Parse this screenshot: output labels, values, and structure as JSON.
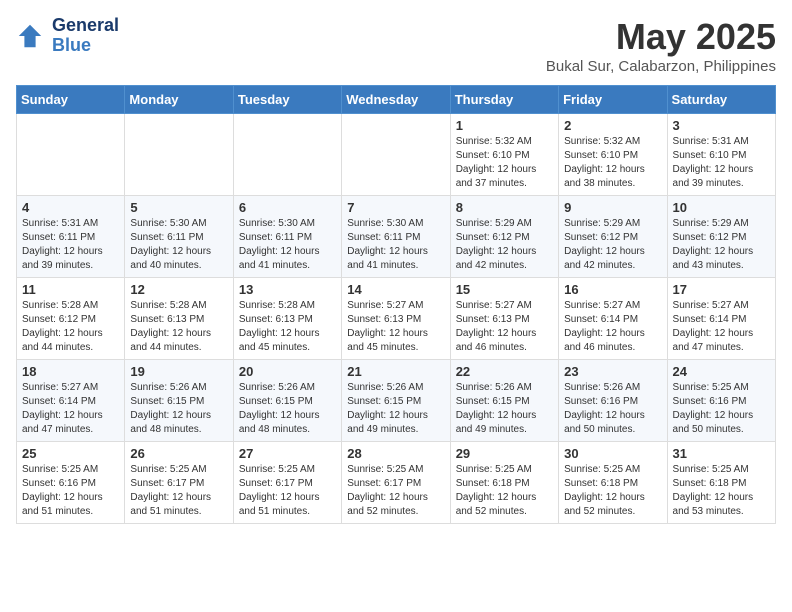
{
  "header": {
    "logo_line1": "General",
    "logo_line2": "Blue",
    "title": "May 2025",
    "subtitle": "Bukal Sur, Calabarzon, Philippines"
  },
  "weekdays": [
    "Sunday",
    "Monday",
    "Tuesday",
    "Wednesday",
    "Thursday",
    "Friday",
    "Saturday"
  ],
  "weeks": [
    [
      {
        "day": "",
        "info": ""
      },
      {
        "day": "",
        "info": ""
      },
      {
        "day": "",
        "info": ""
      },
      {
        "day": "",
        "info": ""
      },
      {
        "day": "1",
        "info": "Sunrise: 5:32 AM\nSunset: 6:10 PM\nDaylight: 12 hours\nand 37 minutes."
      },
      {
        "day": "2",
        "info": "Sunrise: 5:32 AM\nSunset: 6:10 PM\nDaylight: 12 hours\nand 38 minutes."
      },
      {
        "day": "3",
        "info": "Sunrise: 5:31 AM\nSunset: 6:10 PM\nDaylight: 12 hours\nand 39 minutes."
      }
    ],
    [
      {
        "day": "4",
        "info": "Sunrise: 5:31 AM\nSunset: 6:11 PM\nDaylight: 12 hours\nand 39 minutes."
      },
      {
        "day": "5",
        "info": "Sunrise: 5:30 AM\nSunset: 6:11 PM\nDaylight: 12 hours\nand 40 minutes."
      },
      {
        "day": "6",
        "info": "Sunrise: 5:30 AM\nSunset: 6:11 PM\nDaylight: 12 hours\nand 41 minutes."
      },
      {
        "day": "7",
        "info": "Sunrise: 5:30 AM\nSunset: 6:11 PM\nDaylight: 12 hours\nand 41 minutes."
      },
      {
        "day": "8",
        "info": "Sunrise: 5:29 AM\nSunset: 6:12 PM\nDaylight: 12 hours\nand 42 minutes."
      },
      {
        "day": "9",
        "info": "Sunrise: 5:29 AM\nSunset: 6:12 PM\nDaylight: 12 hours\nand 42 minutes."
      },
      {
        "day": "10",
        "info": "Sunrise: 5:29 AM\nSunset: 6:12 PM\nDaylight: 12 hours\nand 43 minutes."
      }
    ],
    [
      {
        "day": "11",
        "info": "Sunrise: 5:28 AM\nSunset: 6:12 PM\nDaylight: 12 hours\nand 44 minutes."
      },
      {
        "day": "12",
        "info": "Sunrise: 5:28 AM\nSunset: 6:13 PM\nDaylight: 12 hours\nand 44 minutes."
      },
      {
        "day": "13",
        "info": "Sunrise: 5:28 AM\nSunset: 6:13 PM\nDaylight: 12 hours\nand 45 minutes."
      },
      {
        "day": "14",
        "info": "Sunrise: 5:27 AM\nSunset: 6:13 PM\nDaylight: 12 hours\nand 45 minutes."
      },
      {
        "day": "15",
        "info": "Sunrise: 5:27 AM\nSunset: 6:13 PM\nDaylight: 12 hours\nand 46 minutes."
      },
      {
        "day": "16",
        "info": "Sunrise: 5:27 AM\nSunset: 6:14 PM\nDaylight: 12 hours\nand 46 minutes."
      },
      {
        "day": "17",
        "info": "Sunrise: 5:27 AM\nSunset: 6:14 PM\nDaylight: 12 hours\nand 47 minutes."
      }
    ],
    [
      {
        "day": "18",
        "info": "Sunrise: 5:27 AM\nSunset: 6:14 PM\nDaylight: 12 hours\nand 47 minutes."
      },
      {
        "day": "19",
        "info": "Sunrise: 5:26 AM\nSunset: 6:15 PM\nDaylight: 12 hours\nand 48 minutes."
      },
      {
        "day": "20",
        "info": "Sunrise: 5:26 AM\nSunset: 6:15 PM\nDaylight: 12 hours\nand 48 minutes."
      },
      {
        "day": "21",
        "info": "Sunrise: 5:26 AM\nSunset: 6:15 PM\nDaylight: 12 hours\nand 49 minutes."
      },
      {
        "day": "22",
        "info": "Sunrise: 5:26 AM\nSunset: 6:15 PM\nDaylight: 12 hours\nand 49 minutes."
      },
      {
        "day": "23",
        "info": "Sunrise: 5:26 AM\nSunset: 6:16 PM\nDaylight: 12 hours\nand 50 minutes."
      },
      {
        "day": "24",
        "info": "Sunrise: 5:25 AM\nSunset: 6:16 PM\nDaylight: 12 hours\nand 50 minutes."
      }
    ],
    [
      {
        "day": "25",
        "info": "Sunrise: 5:25 AM\nSunset: 6:16 PM\nDaylight: 12 hours\nand 51 minutes."
      },
      {
        "day": "26",
        "info": "Sunrise: 5:25 AM\nSunset: 6:17 PM\nDaylight: 12 hours\nand 51 minutes."
      },
      {
        "day": "27",
        "info": "Sunrise: 5:25 AM\nSunset: 6:17 PM\nDaylight: 12 hours\nand 51 minutes."
      },
      {
        "day": "28",
        "info": "Sunrise: 5:25 AM\nSunset: 6:17 PM\nDaylight: 12 hours\nand 52 minutes."
      },
      {
        "day": "29",
        "info": "Sunrise: 5:25 AM\nSunset: 6:18 PM\nDaylight: 12 hours\nand 52 minutes."
      },
      {
        "day": "30",
        "info": "Sunrise: 5:25 AM\nSunset: 6:18 PM\nDaylight: 12 hours\nand 52 minutes."
      },
      {
        "day": "31",
        "info": "Sunrise: 5:25 AM\nSunset: 6:18 PM\nDaylight: 12 hours\nand 53 minutes."
      }
    ]
  ]
}
